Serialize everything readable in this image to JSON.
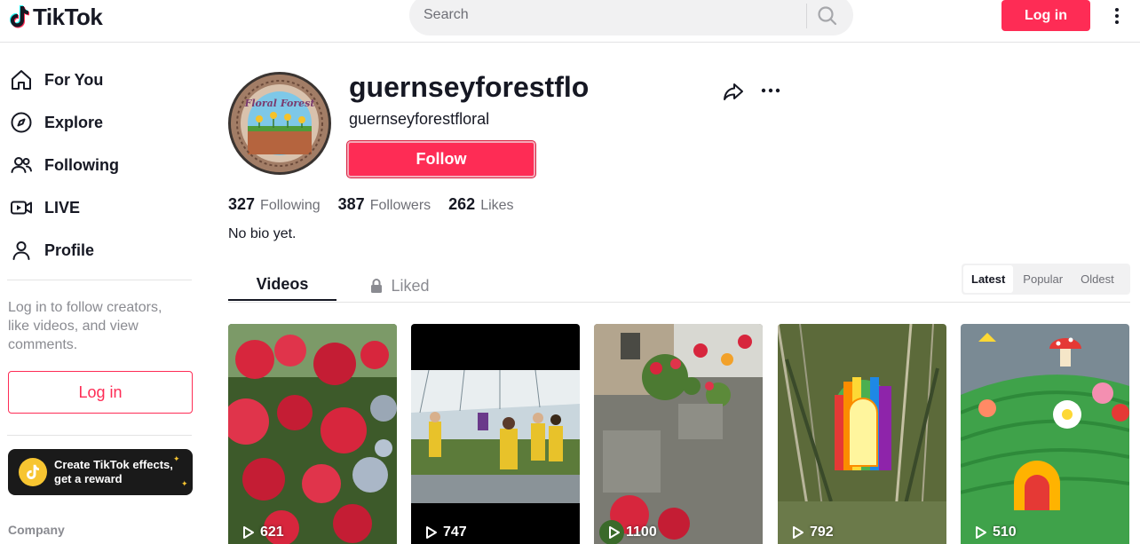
{
  "header": {
    "logo_text": "TikTok",
    "search_placeholder": "Search",
    "login_label": "Log in"
  },
  "sidebar": {
    "items": [
      {
        "label": "For You",
        "icon": "home-icon"
      },
      {
        "label": "Explore",
        "icon": "compass-icon"
      },
      {
        "label": "Following",
        "icon": "users-icon"
      },
      {
        "label": "LIVE",
        "icon": "live-icon"
      },
      {
        "label": "Profile",
        "icon": "person-icon"
      }
    ],
    "login_prompt": "Log in to follow creators, like videos, and view comments.",
    "login_label": "Log in",
    "effects_banner": "Create TikTok effects, get a reward",
    "footer_heading": "Company"
  },
  "profile": {
    "username": "guernseyforestflo",
    "nickname": "guernseyforestfloral",
    "follow_label": "Follow",
    "stats": {
      "following": {
        "count": "327",
        "label": "Following"
      },
      "followers": {
        "count": "387",
        "label": "Followers"
      },
      "likes": {
        "count": "262",
        "label": "Likes"
      }
    },
    "bio": "No bio yet.",
    "avatar_text": "Floral Forest"
  },
  "tabs": {
    "videos": "Videos",
    "liked": "Liked",
    "sort": [
      "Latest",
      "Popular",
      "Oldest"
    ],
    "sort_selected": "Latest"
  },
  "videos": [
    {
      "views": "621",
      "subject": "red flowers hanging basket"
    },
    {
      "views": "747",
      "subject": "students in greenhouse"
    },
    {
      "views": "1100",
      "subject": "flower planters by stone building"
    },
    {
      "views": "792",
      "subject": "rainbow fairy door in grass"
    },
    {
      "views": "510",
      "subject": "crochet fairy garden"
    }
  ],
  "colors": {
    "brand": "#fe2c55",
    "text": "#161823",
    "muted": "#8a8b91"
  }
}
